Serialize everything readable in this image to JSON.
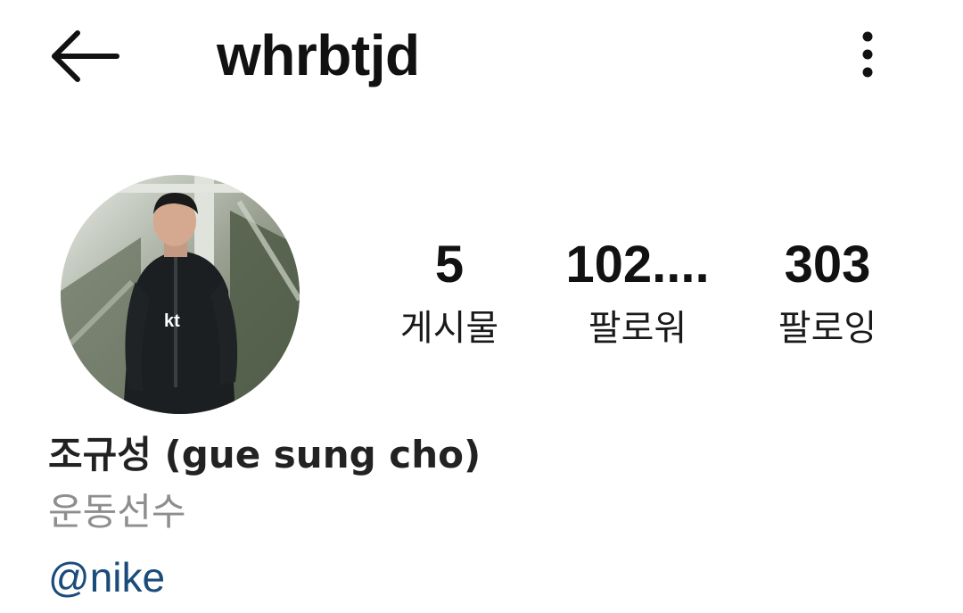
{
  "header": {
    "back_icon": "arrow-left-icon",
    "username": "whrbtjd",
    "more_icon": "more-vertical-icon"
  },
  "profile": {
    "avatar_icon": "profile-photo-avatar",
    "stats": [
      {
        "value": "5",
        "label": "게시물"
      },
      {
        "value": "102....",
        "label": "팔로워"
      },
      {
        "value": "303",
        "label": "팔로잉"
      }
    ],
    "display_name": "조규성 (gue sung cho)",
    "category": "운동선수",
    "mention": "@nike"
  },
  "colors": {
    "text": "#111111",
    "muted": "#8e8e8e",
    "link": "#1a4b7a",
    "background": "#ffffff"
  }
}
